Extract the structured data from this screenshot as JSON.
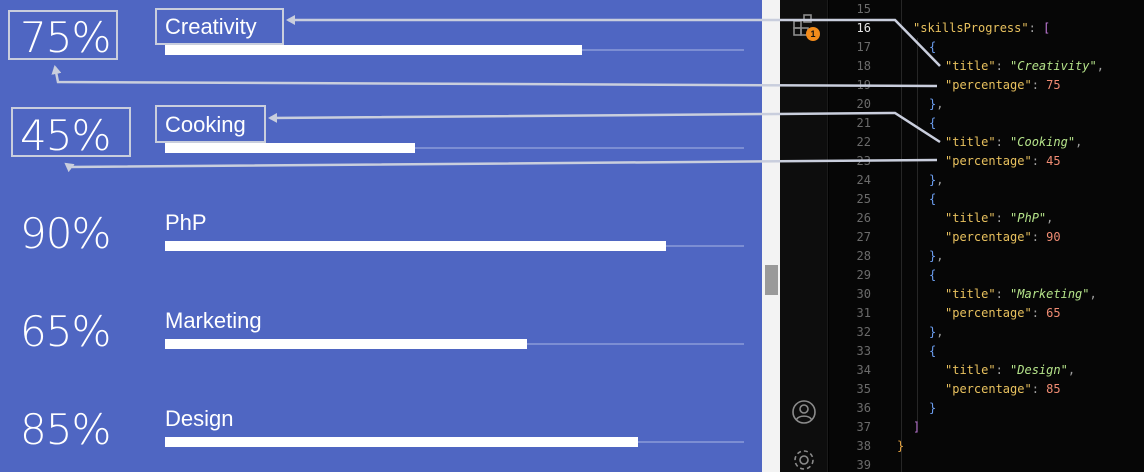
{
  "skills": [
    {
      "title": "Creativity",
      "percentage": 75,
      "label": "75%"
    },
    {
      "title": "Cooking",
      "percentage": 45,
      "label": "45%"
    },
    {
      "title": "PhP",
      "percentage": 90,
      "label": "90%"
    },
    {
      "title": "Marketing",
      "percentage": 65,
      "label": "65%"
    },
    {
      "title": "Design",
      "percentage": 85,
      "label": "85%"
    }
  ],
  "activity_bar": {
    "icons": [
      "extensions-icon",
      "account-icon",
      "settings-gear-icon"
    ],
    "badge_count": "1"
  },
  "editor": {
    "active_line": "16",
    "line_numbers": [
      "15",
      "16",
      "17",
      "18",
      "19",
      "20",
      "21",
      "22",
      "23",
      "24",
      "25",
      "26",
      "27",
      "28",
      "29",
      "30",
      "31",
      "32",
      "33",
      "34",
      "35",
      "36",
      "37",
      "38",
      "39"
    ],
    "code": {
      "array_key": "\"skillsProgress\"",
      "title_key": "\"title\"",
      "percentage_key": "\"percentage\"",
      "items": [
        {
          "title": "\"Creativity\"",
          "percentage": "75"
        },
        {
          "title": "\"Cooking\"",
          "percentage": "45"
        },
        {
          "title": "\"PhP\"",
          "percentage": "90"
        },
        {
          "title": "\"Marketing\"",
          "percentage": "65"
        },
        {
          "title": "\"Design\"",
          "percentage": "85"
        }
      ]
    }
  },
  "colors": {
    "panel_bg": "#4F66C2",
    "bar_fill": "#FFFFFF",
    "bar_track": "#7C8ED3",
    "callout_stroke": "#C9CEDD",
    "badge": "#F28B1B",
    "editor_bg": "#060606",
    "json_key": "#E8C15E",
    "json_string": "#B5E38A",
    "json_number": "#F08C73"
  }
}
